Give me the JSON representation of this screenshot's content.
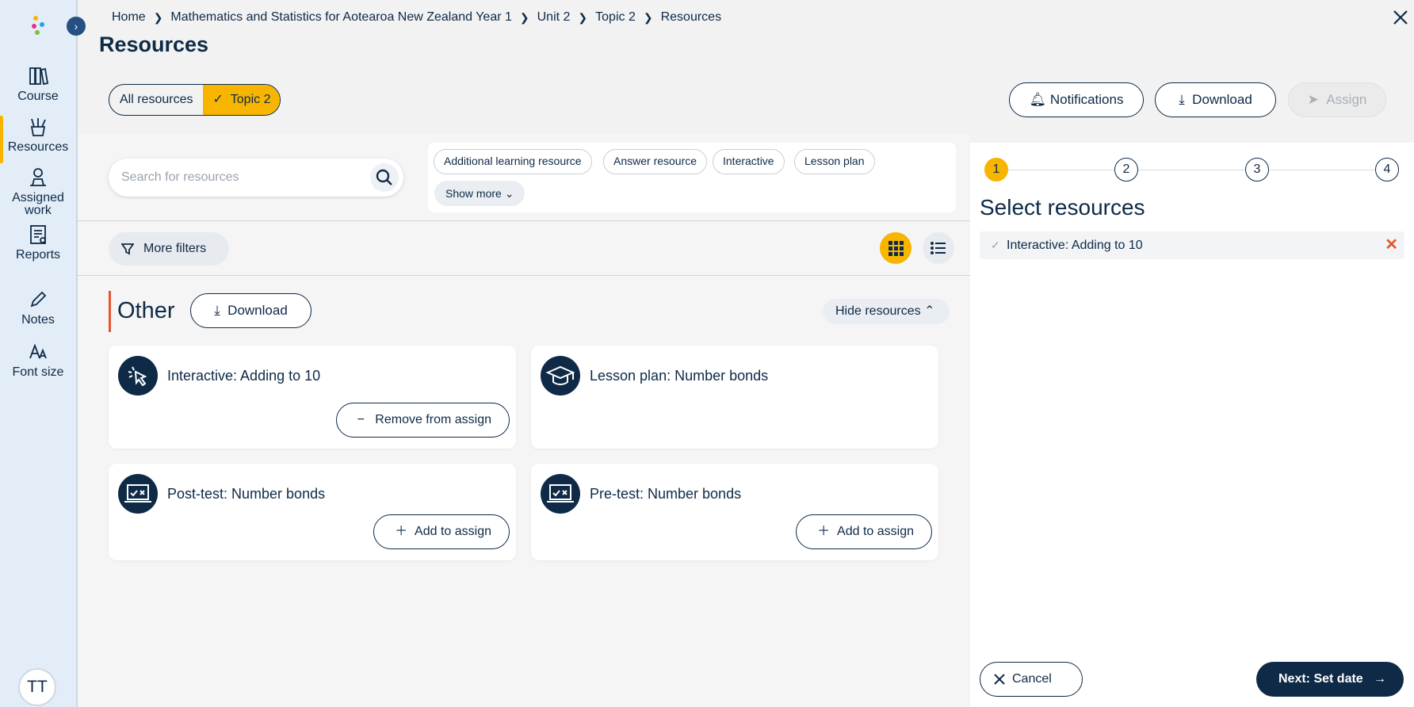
{
  "sidebar": {
    "items": [
      {
        "label": "Course",
        "icon": "books-icon"
      },
      {
        "label": "Resources",
        "icon": "pencil-cup-icon",
        "active": true
      },
      {
        "label": "Assigned work",
        "icon": "person-laptop-icon"
      },
      {
        "label": "Reports",
        "icon": "report-chart-icon"
      },
      {
        "label": "Notes",
        "icon": "pencil-icon"
      },
      {
        "label": "Font size",
        "icon": "font-size-icon"
      }
    ],
    "avatar_initials": "TT",
    "accent_color": "#f7b500"
  },
  "breadcrumb": [
    "Home",
    "Mathematics and Statistics for Aotearoa New Zealand Year 1",
    "Unit 2",
    "Topic 2",
    "Resources"
  ],
  "page_title": "Resources",
  "scope_toggle": {
    "all_label": "All resources",
    "topic_label": "Topic 2",
    "selected": "Topic 2"
  },
  "toolbar": {
    "notifications_label": "Notifications",
    "download_label": "Download",
    "assign_label": "Assign"
  },
  "search": {
    "placeholder": "Search for resources"
  },
  "filter_chips": [
    "Additional learning resource",
    "Answer resource",
    "Interactive",
    "Lesson plan"
  ],
  "show_more_label": "Show more",
  "more_filters_label": "More filters",
  "view_mode": "grid",
  "section": {
    "title": "Other",
    "download_label": "Download",
    "hide_label": "Hide resources",
    "cards": [
      {
        "title": "Interactive: Adding to 10",
        "icon": "cursor-click-icon",
        "action": "Remove from assign"
      },
      {
        "title": "Lesson plan: Number bonds",
        "icon": "graduation-cap-icon",
        "action": ""
      },
      {
        "title": "Post-test: Number bonds",
        "icon": "laptop-test-icon",
        "action": "Add to assign"
      },
      {
        "title": "Pre-test: Number bonds",
        "icon": "laptop-test-icon",
        "action": "Add to assign"
      }
    ]
  },
  "wizard": {
    "steps": [
      "1",
      "2",
      "3",
      "4"
    ],
    "current_step": 1,
    "title": "Select resources",
    "selected": [
      {
        "label": "Interactive: Adding to 10"
      }
    ],
    "cancel_label": "Cancel",
    "next_label": "Next: Set date"
  }
}
